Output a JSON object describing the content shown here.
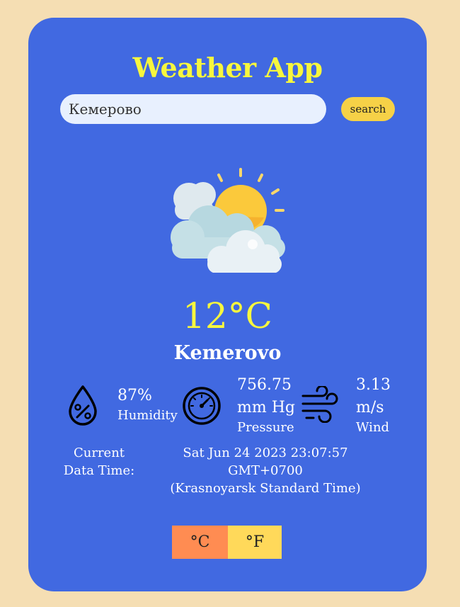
{
  "app": {
    "title": "Weather App"
  },
  "search": {
    "value": "Кемерово",
    "button_label": "search"
  },
  "weather": {
    "icon": "sun-behind-clouds-icon",
    "temperature": "12°C",
    "city": "Kemerovo"
  },
  "metrics": {
    "humidity": {
      "value": "87%",
      "label": "Humidity",
      "icon": "humidity-drop-icon"
    },
    "pressure": {
      "value_line1": "756.75",
      "value_line2": "mm Hg",
      "label": "Pressure",
      "icon": "pressure-gauge-icon"
    },
    "wind": {
      "value_line1": "3.13",
      "value_line2": "m/s",
      "label": "Wind",
      "icon": "wind-icon"
    }
  },
  "datetime": {
    "label_line1": "Current",
    "label_line2": "Data Time:",
    "value_line1": "Sat Jun 24 2023 23:07:57 GMT+0700",
    "value_line2": "(Krasnoyarsk Standard Time)"
  },
  "units": {
    "celsius_label": "°C",
    "fahrenheit_label": "°F"
  },
  "colors": {
    "page_background": "#f5deb3",
    "card_background": "#4169e1",
    "title_color": "#f7f73d",
    "search_button": "#f6d147",
    "celsius_button": "#ff8c52",
    "fahrenheit_button": "#ffd95a"
  }
}
